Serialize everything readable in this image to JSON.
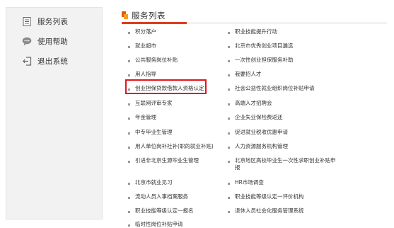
{
  "sidebar": {
    "items": [
      {
        "label": "服务列表",
        "icon": "document-icon"
      },
      {
        "label": "使用帮助",
        "icon": "chat-bubble-icon"
      },
      {
        "label": "退出系统",
        "icon": "exit-icon"
      }
    ]
  },
  "main": {
    "title": "服务列表",
    "services_left": [
      "积分落户",
      "就业超市",
      "公共服务岗位补贴",
      "用人指导",
      "创业担保贷款借款人资格认定",
      "互联网评审专家",
      "年金管理",
      "中专毕业生管理",
      "用人单位岗补社补(职的就业补贴)",
      "引进非北京生源毕业生管理",
      "北京市就业见习",
      "流动人员人事档案服务",
      "职业技能等级认定一报名",
      "临时性岗位补贴申请"
    ],
    "services_right": [
      "职业技能提升行动",
      "北京市优秀创业项目遴选",
      "一次性创业担保服务补助",
      "我要招人才",
      "社会公益性就业组织岗位补贴申请",
      "高端人才招聘会",
      "企业失业保险费返还",
      "促进就业税收优惠申请",
      "人力资源服务机构管理",
      "北京地区高校毕业生一次性求职创业补贴申报",
      "HR市场调查",
      "职业技能等级认定一评价机构",
      "退休人员社会化服务管理系统"
    ],
    "highlighted_service": "创业担保贷款借款人资格认定"
  },
  "colors": {
    "accent_red": "#e23b1f",
    "highlight_border": "#e3141b",
    "marker_orange": "#e8541e",
    "marker_yellow": "#f4a21c",
    "sidebar_bg": "#f2f2f2"
  }
}
